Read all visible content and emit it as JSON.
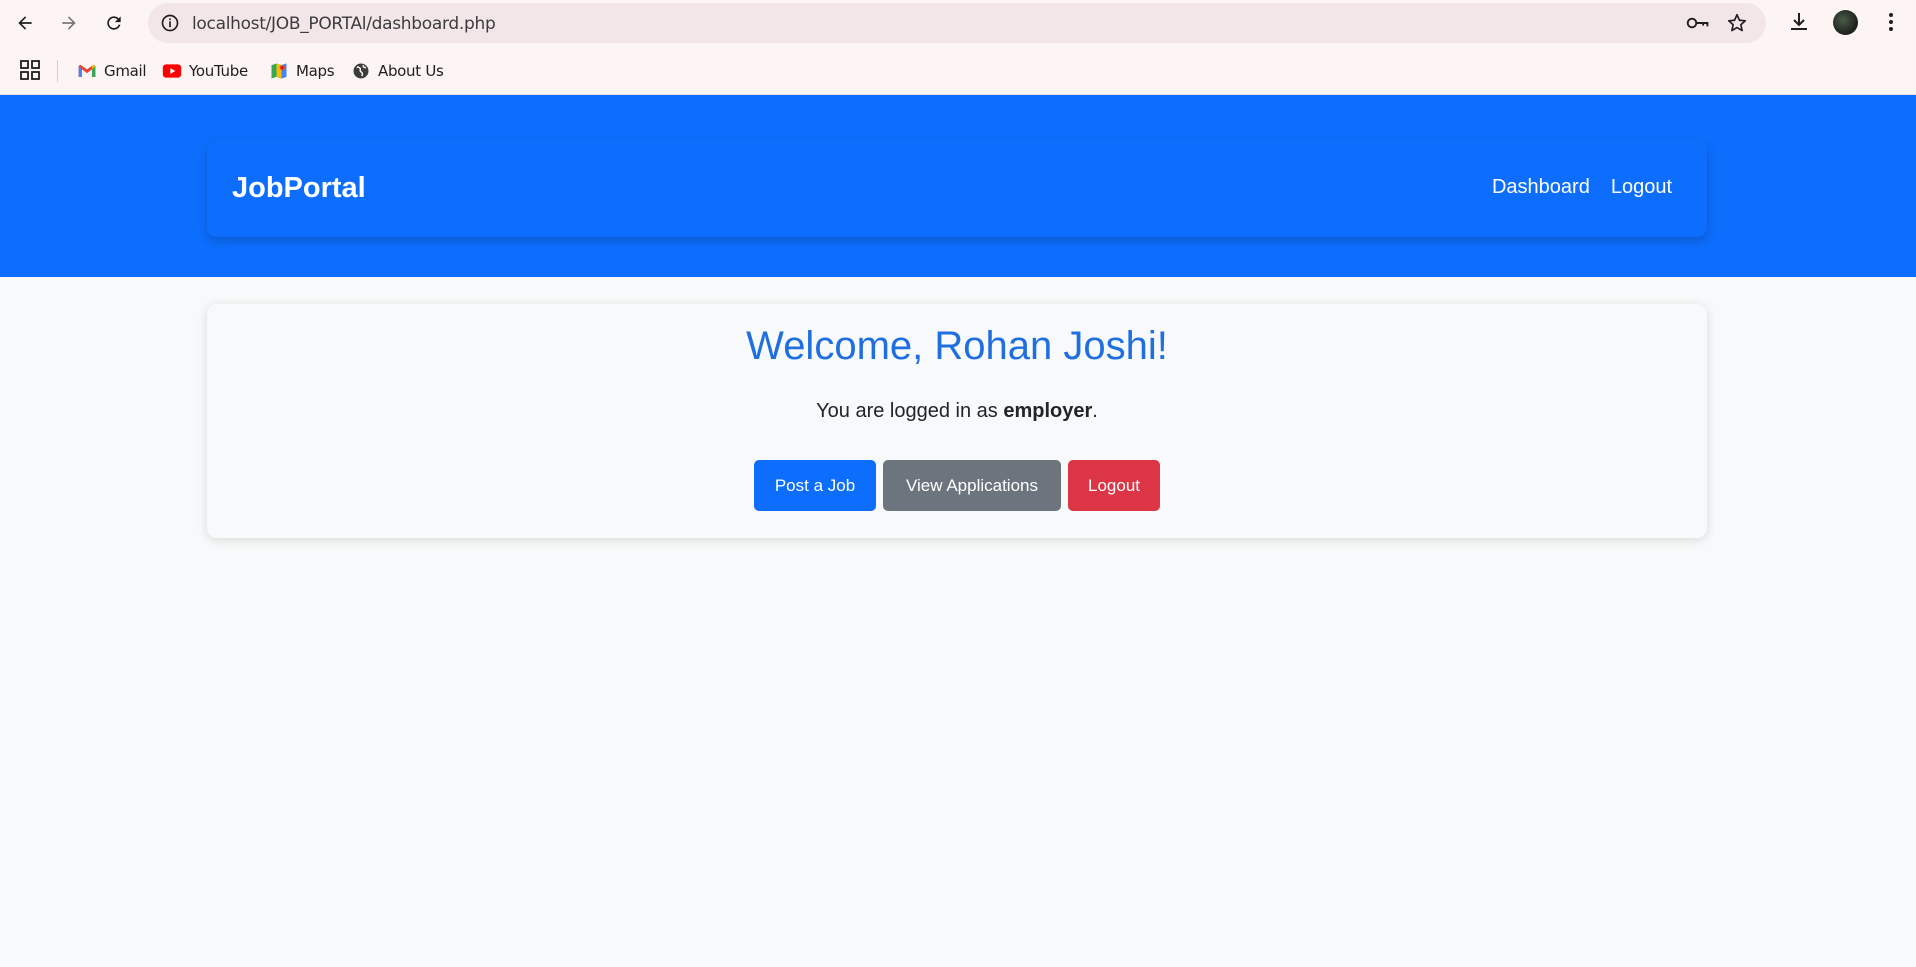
{
  "browser": {
    "url": "localhost/JOB_PORTAl/dashboard.php",
    "bookmarks": [
      {
        "label": "Gmail",
        "icon": "gmail-icon"
      },
      {
        "label": "YouTube",
        "icon": "youtube-icon"
      },
      {
        "label": "Maps",
        "icon": "maps-icon"
      },
      {
        "label": "About Us",
        "icon": "globe-icon"
      }
    ]
  },
  "navbar": {
    "brand": "JobPortal",
    "links": {
      "dashboard": "Dashboard",
      "logout": "Logout"
    }
  },
  "card": {
    "welcome": "Welcome, Rohan Joshi!",
    "role_prefix": "You are logged in as ",
    "role": "employer",
    "role_suffix": ".",
    "buttons": {
      "post_job": "Post a Job",
      "view_applications": "View Applications",
      "logout": "Logout"
    }
  },
  "colors": {
    "primary": "#0d6efd",
    "secondary": "#6c757d",
    "danger": "#dc3545",
    "welcome_text": "#1f6fe0"
  }
}
